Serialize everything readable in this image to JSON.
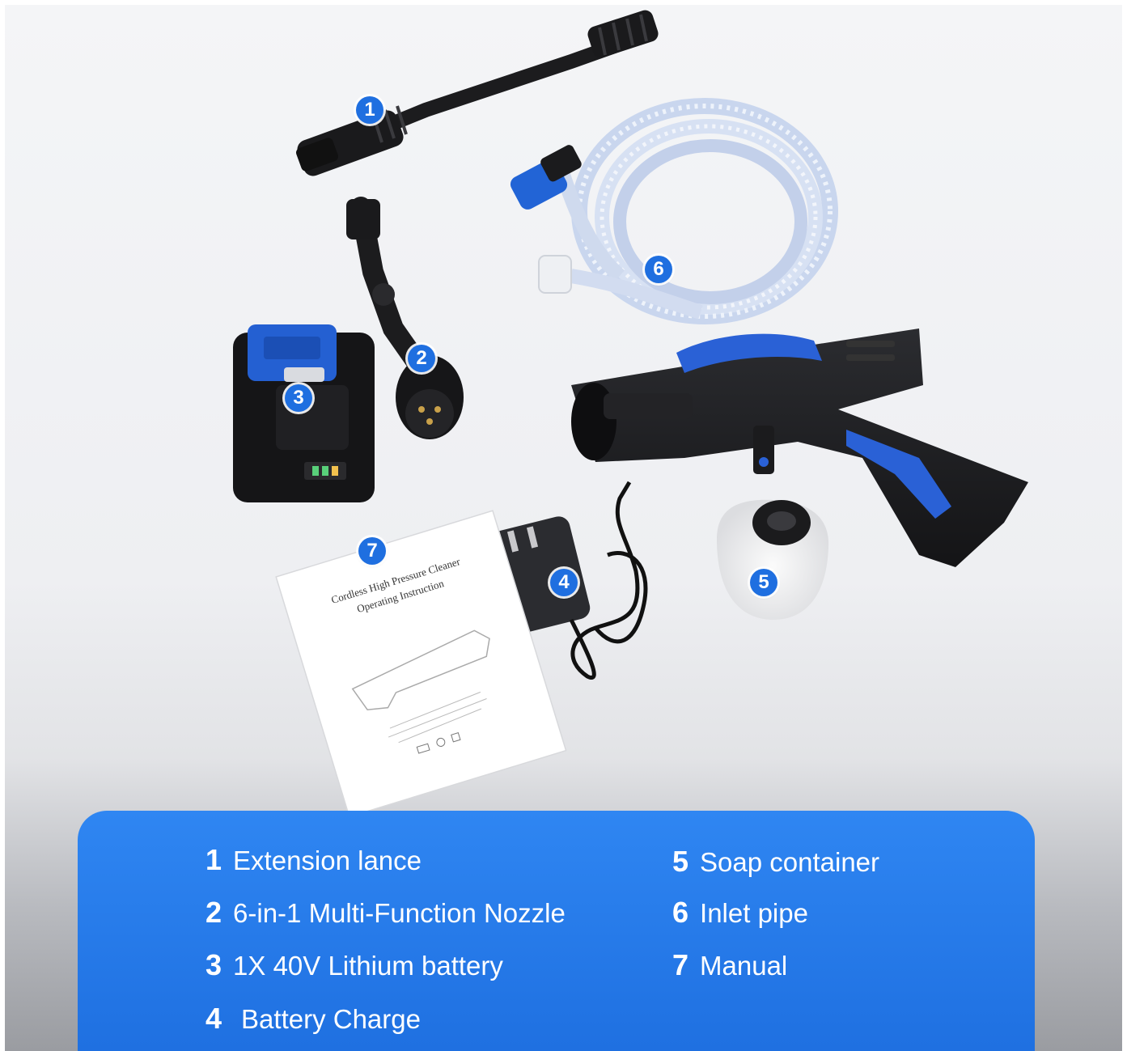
{
  "markers": [
    "1",
    "2",
    "3",
    "4",
    "5",
    "6",
    "7"
  ],
  "manual": {
    "title_line1": "Cordless High Pressure Cleaner",
    "title_line2": "Operating Instruction"
  },
  "legend": {
    "left": [
      {
        "num": "1",
        "label": "Extension lance"
      },
      {
        "num": "2",
        "label": "6-in-1 Multi-Function Nozzle"
      },
      {
        "num": "3",
        "label": "1X 40V Lithium battery"
      },
      {
        "num": "4",
        "label": "Battery Charge"
      }
    ],
    "right": [
      {
        "num": "5",
        "label": "Soap container"
      },
      {
        "num": "6",
        "label": "Inlet pipe"
      },
      {
        "num": "7",
        "label": "Manual"
      }
    ]
  },
  "colors": {
    "panel_blue": "#1f6fe0",
    "accent_blue": "#2563d9",
    "tool_black": "#1b1b1d"
  }
}
